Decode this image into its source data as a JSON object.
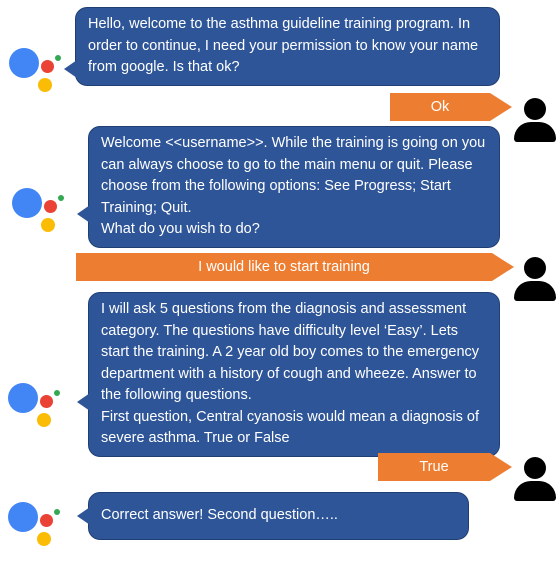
{
  "messages": [
    {
      "sender": "assistant",
      "text": "Hello, welcome to the asthma guideline training program. In order to continue, I need your permission to know your name from google. Is that ok?"
    },
    {
      "sender": "user",
      "text": "Ok"
    },
    {
      "sender": "assistant",
      "lines": [
        "Welcome <<username>>. While the training is going on you can always choose to go to the main menu or quit. Please choose from the following options: See Progress; Start Training; Quit.",
        "What do you wish to do?"
      ]
    },
    {
      "sender": "user",
      "text": "I would like to start training"
    },
    {
      "sender": "assistant",
      "lines": [
        "I will ask 5 questions from the diagnosis and assessment category. The questions have difficulty level ‘Easy’. Lets start the training. A 2 year old boy comes to the emergency department with a history of cough and wheeze. Answer to the following questions.",
        "First question, Central cyanosis would mean a diagnosis of severe asthma. True or False"
      ]
    },
    {
      "sender": "user",
      "text": "True"
    },
    {
      "sender": "assistant",
      "text": "Correct answer! Second question….."
    }
  ],
  "icons": {
    "assistant": "google-assistant-icon",
    "user": "user-avatar-icon"
  },
  "colors": {
    "assistant_bubble": "#2E5597",
    "user_bubble": "#ED7D31",
    "assistant_logo": [
      "#4285F4",
      "#EA4335",
      "#FBBC05",
      "#34A853"
    ]
  }
}
